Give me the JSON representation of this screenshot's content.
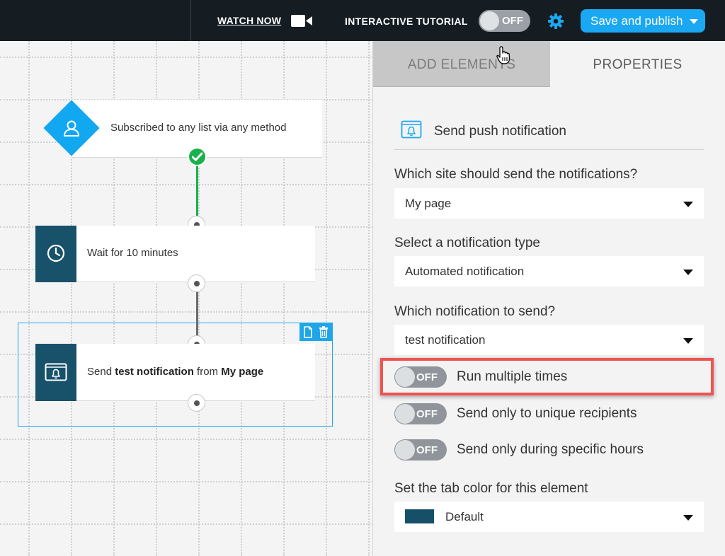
{
  "topbar": {
    "watch_now": "WATCH NOW",
    "tutorial_label": "INTERACTIVE TUTORIAL",
    "tutorial_toggle": "OFF",
    "publish_label": "Save and publish",
    "icons": [
      "video-camera-icon",
      "gear-icon",
      "chevron-down-icon"
    ]
  },
  "canvas": {
    "trigger": {
      "label": "Subscribed to any list via any method",
      "icon": "user-icon",
      "status_icon": "check-icon"
    },
    "wait_step": {
      "label": "Wait for 10 minutes",
      "icon": "clock-icon"
    },
    "send_step": {
      "prefix": "Send ",
      "notification": "test notification",
      "middle": " from ",
      "site": "My page",
      "icon": "push-notification-icon"
    },
    "selection_tools": [
      "copy-icon",
      "trash-icon"
    ]
  },
  "panel": {
    "tabs": {
      "add": "ADD ELEMENTS",
      "properties": "PROPERTIES"
    },
    "section_title": "Send push notification",
    "site_label": "Which site should send the notifications?",
    "site_value": "My page",
    "type_label": "Select a notification type",
    "type_value": "Automated notification",
    "which_label": "Which notification to send?",
    "which_value": "test notification",
    "toggles": [
      {
        "state": "OFF",
        "label": "Run multiple times"
      },
      {
        "state": "OFF",
        "label": "Send only to unique recipients"
      },
      {
        "state": "OFF",
        "label": "Send only during specific hours"
      }
    ],
    "tab_color_label": "Set the tab color for this element",
    "tab_color_value": "Default",
    "tab_color_swatch": "#154f68"
  },
  "colors": {
    "topbar_bg": "#151c22",
    "accent_blue": "#1ba8f2",
    "step_tile": "#18516a",
    "success": "#19b14a",
    "highlight": "#ef5350"
  }
}
